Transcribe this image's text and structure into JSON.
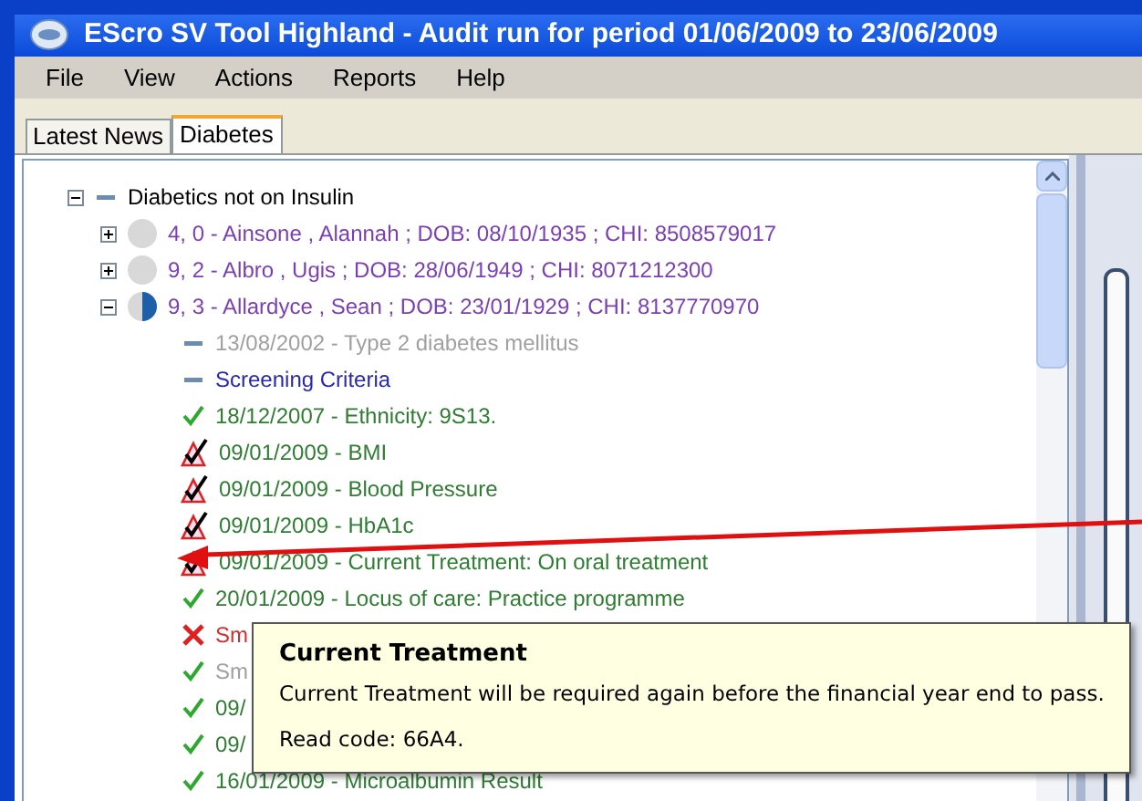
{
  "window": {
    "title": "EScro SV Tool Highland - Audit run for period 01/06/2009 to 23/06/2009"
  },
  "menu": [
    "File",
    "View",
    "Actions",
    "Reports",
    "Help"
  ],
  "tabs": [
    {
      "label": "Latest News",
      "selected": false
    },
    {
      "label": "Diabetes",
      "selected": true
    }
  ],
  "tree": {
    "label": "Diabetics not on Insulin",
    "expanded": true,
    "children": [
      {
        "label": "4, 0 - Ainsone , Alannah  ; DOB: 08/10/1935 ; CHI: 8508579017",
        "expanded": false,
        "kind": "empty",
        "color": "#7b3fb5"
      },
      {
        "label": "9, 2 - Albro , Ugis  ; DOB: 28/06/1949 ; CHI: 8071212300",
        "expanded": false,
        "kind": "empty",
        "color": "#7b3fb5"
      },
      {
        "label": "9, 3 - Allardyce , Sean  ; DOB: 23/01/1929 ; CHI: 8137770970",
        "expanded": true,
        "kind": "half",
        "color": "#7b3fb5",
        "children": [
          {
            "kind": "dash",
            "text": "13/08/2002 - Type 2 diabetes mellitus",
            "color": "#a0a0a0"
          },
          {
            "kind": "dash",
            "text": "Screening Criteria",
            "color": "#2a2ab0"
          },
          {
            "kind": "check",
            "text": "18/12/2007 - Ethnicity: 9S13.",
            "color": "#2e7d32"
          },
          {
            "kind": "warn",
            "text": "09/01/2009 - BMI",
            "color": "#2e7d32"
          },
          {
            "kind": "warn",
            "text": "09/01/2009 - Blood Pressure",
            "color": "#2e7d32"
          },
          {
            "kind": "warn",
            "text": "09/01/2009 - HbA1c",
            "color": "#2e7d32"
          },
          {
            "kind": "warn",
            "text": "09/01/2009 - Current Treatment: On oral treatment",
            "color": "#2e7d32"
          },
          {
            "kind": "check",
            "text": "20/01/2009 - Locus of care: Practice programme",
            "color": "#2e7d32"
          },
          {
            "kind": "cross",
            "text": "Sm",
            "color": "#d32f2f"
          },
          {
            "kind": "check",
            "text": "Sm",
            "color": "#a0a0a0"
          },
          {
            "kind": "check",
            "text": "09/",
            "color": "#2e7d32"
          },
          {
            "kind": "check",
            "text": "09/",
            "color": "#2e7d32"
          },
          {
            "kind": "check",
            "text": "16/01/2009 - Microalbumin Result",
            "color": "#2e7d32"
          }
        ]
      }
    ]
  },
  "tooltip": {
    "title": "Current Treatment",
    "body": "Current Treatment will be required again before the financial year end to pass.",
    "read_code": "Read code: 66A4."
  }
}
